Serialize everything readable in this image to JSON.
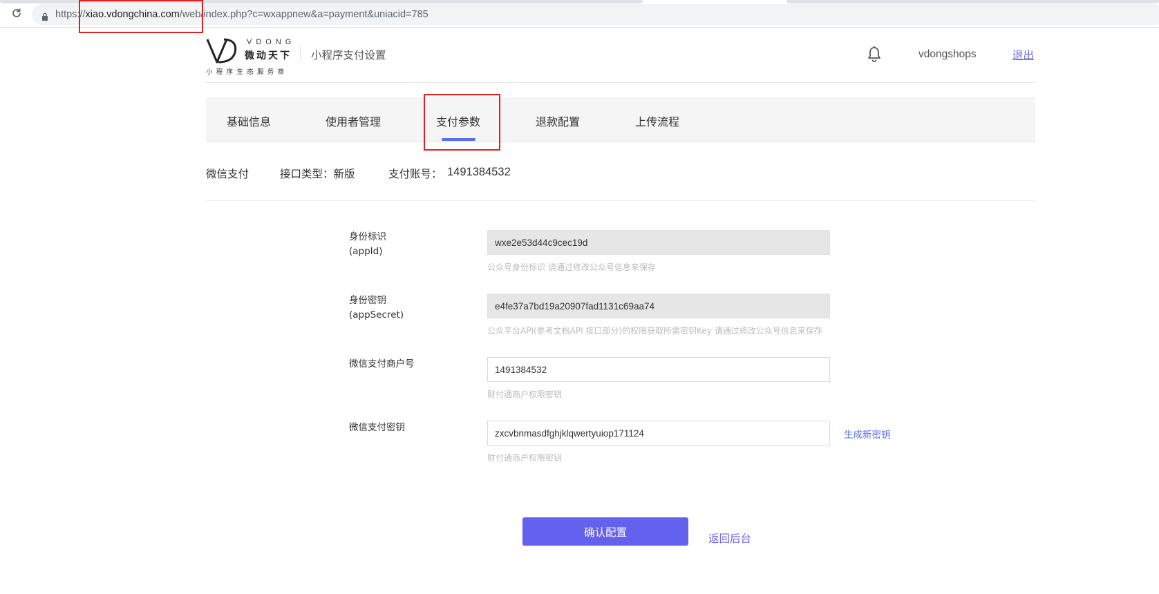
{
  "browser": {
    "url_scheme": "https://",
    "url_host": "xiao.vdongchina.com",
    "url_path": "/web/index.php?c=wxappnew&a=payment&uniacid=785",
    "icons": [
      "reload-icon",
      "lock-icon"
    ]
  },
  "header": {
    "logo_en": "VDONG",
    "logo_cn": "微动天下",
    "logo_sub": "小程序生态服务商",
    "title": "小程序支付设置",
    "username": "vdongshops",
    "logout_label": "退出",
    "icons": [
      "bell-icon"
    ]
  },
  "tabs": [
    {
      "label": "基础信息",
      "active": false
    },
    {
      "label": "使用者管理",
      "active": false
    },
    {
      "label": "支付参数",
      "active": true
    },
    {
      "label": "退款配置",
      "active": false
    },
    {
      "label": "上传流程",
      "active": false
    }
  ],
  "payment": {
    "method": "微信支付",
    "interface_type": "接口类型：新版",
    "account_label": "支付账号：",
    "account_value": "1491384532"
  },
  "form": {
    "appid": {
      "label_cn": "身份标识",
      "label_en": "(appId)",
      "value": "wxe2e53d44c9cec19d",
      "help": "公众号身份标识 请通过修改公众号信息来保存"
    },
    "appsecret": {
      "label_cn": "身份密钥",
      "label_en": "(appSecret)",
      "value": "e4fe37a7bd19a20907fad1131c69aa74",
      "help": "公众平台API(参考文档API 接口部分)的权限获取所需密钥Key 请通过修改公众号信息来保存"
    },
    "mchid": {
      "label": "微信支付商户号",
      "value": "1491384532",
      "help": "财付通商户权限密钥"
    },
    "paykey": {
      "label": "微信支付密钥",
      "value": "zxcvbnmasdfghjklqwertyuiop171124",
      "help": "财付通商户权限密钥",
      "generate_label": "生成新密钥"
    },
    "confirm_label": "确认配置",
    "back_label": "返回后台"
  },
  "colors": {
    "accent": "#6461ee",
    "link": "#6b63e8",
    "tab_indicator": "#5a6ef0",
    "annotation_red": "#e02020"
  }
}
